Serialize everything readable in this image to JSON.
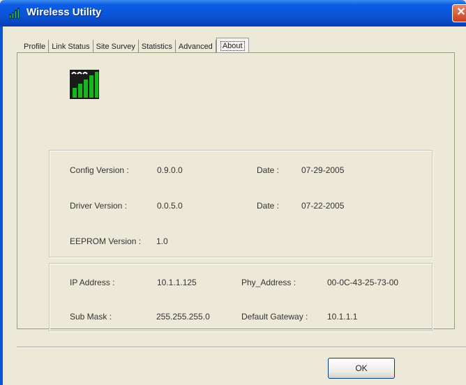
{
  "window": {
    "title": "Wireless Utility"
  },
  "tabs": [
    {
      "label": "Profile",
      "active": false
    },
    {
      "label": "Link Status",
      "active": false
    },
    {
      "label": "Site Survey",
      "active": false
    },
    {
      "label": "Statistics",
      "active": false
    },
    {
      "label": "Advanced",
      "active": false
    },
    {
      "label": "About",
      "active": true
    }
  ],
  "about": {
    "config_version_label": "Config Version :",
    "config_version": "0.9.0.0",
    "config_date_label": "Date :",
    "config_date": "07-29-2005",
    "driver_version_label": "Driver Version :",
    "driver_version": "0.0.5.0",
    "driver_date_label": "Date :",
    "driver_date": "07-22-2005",
    "eeprom_label": "EEPROM Version :",
    "eeprom_version": "1.0"
  },
  "network": {
    "ip_label": "IP Address :",
    "ip": "10.1.1.125",
    "phy_label": "Phy_Address :",
    "phy": "00-0C-43-25-73-00",
    "mask_label": "Sub Mask :",
    "mask": "255.255.255.0",
    "gateway_label": "Default Gateway :",
    "gateway": "10.1.1.1"
  },
  "buttons": {
    "ok": "OK",
    "close": "✕"
  },
  "colors": {
    "titlebar": "#0a55d8",
    "face": "#ece9d8",
    "signal_green": "#19b51f"
  }
}
